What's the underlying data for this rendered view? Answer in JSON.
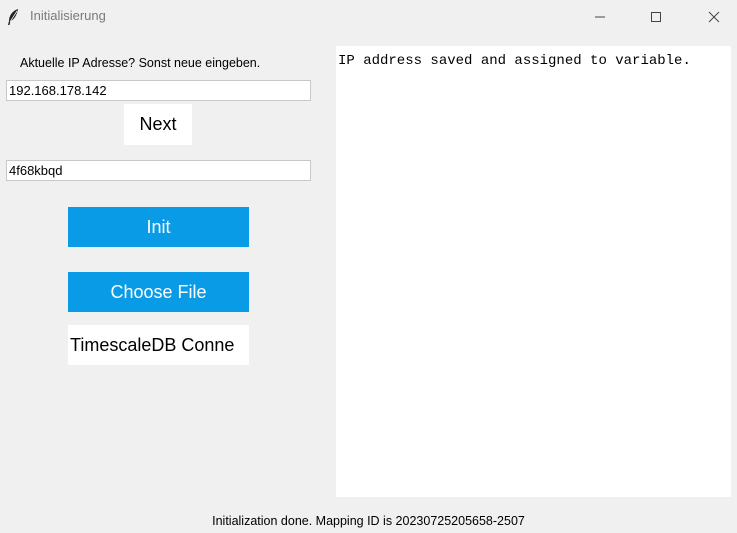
{
  "window": {
    "title": "Initialisierung",
    "icon": "feather-icon"
  },
  "form": {
    "ip_label": "Aktuelle IP Adresse? Sonst neue eingeben.",
    "ip_value": "192.168.178.142",
    "next_label": "Next",
    "key_value": "4f68kbqd",
    "init_label": "Init",
    "choose_file_label": "Choose File",
    "timescale_label": "TimescaleDB Conne"
  },
  "log": {
    "text": "IP address saved and assigned to variable."
  },
  "status": {
    "text": "Initialization done. Mapping ID is 20230725205658-2507"
  },
  "colors": {
    "accent_button": "#0a9be6",
    "background": "#f0f0f0"
  }
}
